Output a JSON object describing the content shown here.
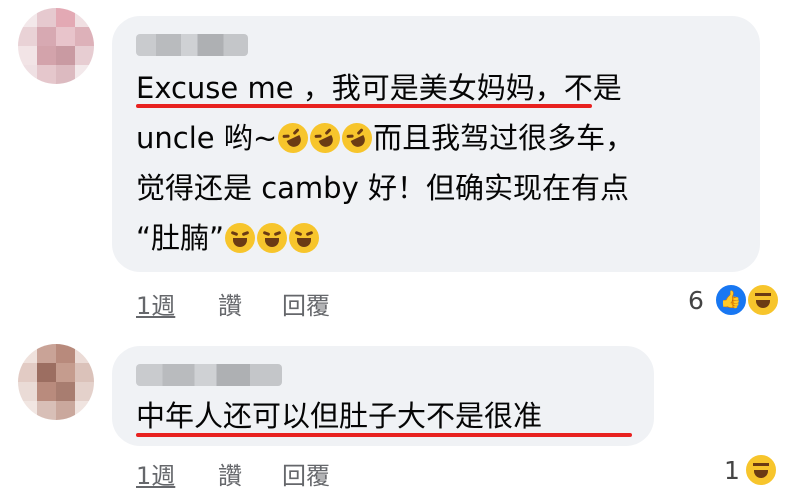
{
  "comment1": {
    "lines": [
      "Excuse me ，我可是美女妈妈，不是",
      "uncle 哟~",
      "而且我驾过很多车，",
      "觉得还是 camby 好！但确实现在有点",
      "“肚腩”"
    ],
    "actions": {
      "time": "1週",
      "like": "讚",
      "reply": "回覆"
    },
    "reaction_count": "6",
    "reactions": [
      "like-icon",
      "haha-icon"
    ],
    "inline_emojis": [
      "rolling-laughing-icon",
      "tears-of-joy-icon"
    ]
  },
  "comment2": {
    "lines": [
      "中年人还可以但肚子大不是很准"
    ],
    "actions": {
      "time": "1週",
      "like": "讚",
      "reply": "回覆"
    },
    "reaction_count": "1",
    "reactions": [
      "haha-icon"
    ]
  },
  "colors": {
    "bubble": "#f0f2f5",
    "underline": "#e8211f",
    "like": "#1877f2",
    "emoji": "#f7c52c"
  }
}
